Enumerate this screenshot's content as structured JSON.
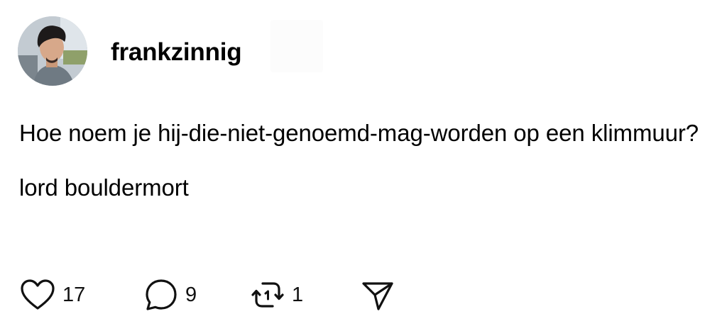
{
  "post": {
    "author": {
      "username": "frankzinnig"
    },
    "question": "Hoe noem je hij-die-niet-genoemd-mag-worden op een klimmuur?",
    "answer": "lord bouldermort",
    "stats": {
      "likes": "17",
      "replies": "9",
      "reposts": "1"
    }
  },
  "icons": {
    "like": "heart-icon",
    "reply": "speech-bubble-icon",
    "repost": "repost-arrows-icon",
    "share": "paper-plane-icon"
  },
  "colors": {
    "text": "#000000",
    "icon": "#111111",
    "background": "#ffffff"
  }
}
